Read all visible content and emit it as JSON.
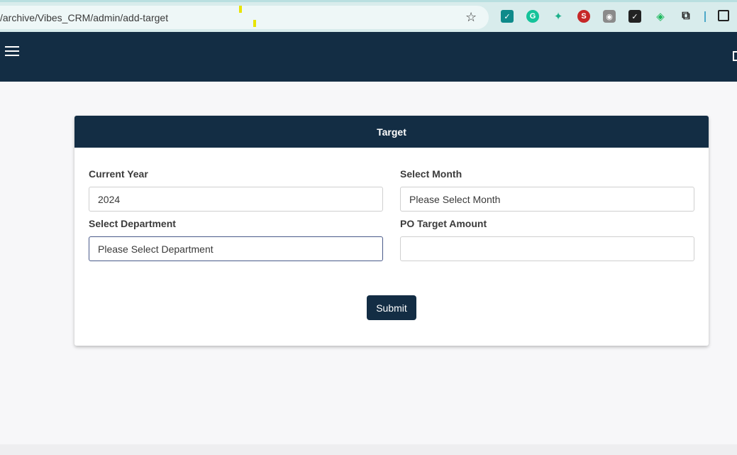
{
  "browser": {
    "url": "/archive/Vibes_CRM/admin/add-target"
  },
  "icons": {
    "menu": "hamburger-icon",
    "star": "star-icon",
    "fullscreen": "fullscreen-icon"
  },
  "form": {
    "title": "Target",
    "current_year": {
      "label": "Current Year",
      "value": "2024"
    },
    "month": {
      "label": "Select Month",
      "value": "Please Select Month"
    },
    "department": {
      "label": "Select Department",
      "value": "Please Select Department"
    },
    "po_target": {
      "label": "PO Target Amount",
      "value": ""
    },
    "submit_label": "Submit"
  },
  "colors": {
    "brand": "#132d44",
    "background": "#f7f7f9"
  }
}
